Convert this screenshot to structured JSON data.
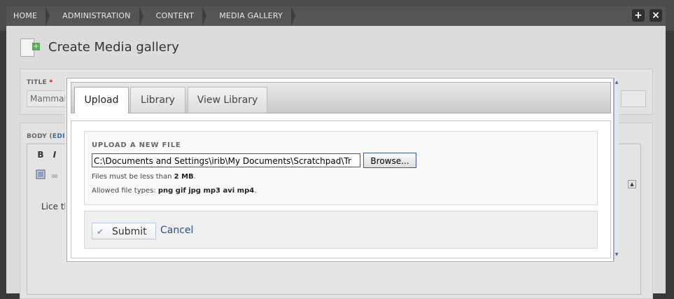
{
  "breadcrumb": [
    "HOME",
    "ADMINISTRATION",
    "CONTENT",
    "MEDIA GALLERY"
  ],
  "top_buttons": {
    "add": "+",
    "close": "×"
  },
  "page": {
    "title": "Create Media gallery",
    "title_field_label": "TITLE",
    "required_mark": "*",
    "title_value": "Mammal",
    "body_label": "BODY (",
    "body_edit_link": "EDIT",
    "editor_text": "Lice th",
    "toolbar": {
      "bold": "B",
      "italic": "I"
    }
  },
  "modal": {
    "tabs": [
      {
        "label": "Upload",
        "active": true
      },
      {
        "label": "Library",
        "active": false
      },
      {
        "label": "View Library",
        "active": false
      }
    ],
    "upload_label": "UPLOAD A NEW FILE",
    "file_value": "C:\\Documents and Settings\\irib\\My Documents\\Scratchpad\\Tr",
    "browse_label": "Browse...",
    "help_size_prefix": "Files must be less than ",
    "help_size_value": "2 MB",
    "help_size_suffix": ".",
    "help_types_prefix": "Allowed file types: ",
    "help_types_value": "png gif jpg mp3 avi mp4",
    "help_types_suffix": ".",
    "submit_label": "Submit",
    "cancel_label": "Cancel"
  },
  "colors": {
    "accent_link": "#2a4f8c",
    "required": "#cc0000",
    "topbar": "#4b4b4b"
  }
}
